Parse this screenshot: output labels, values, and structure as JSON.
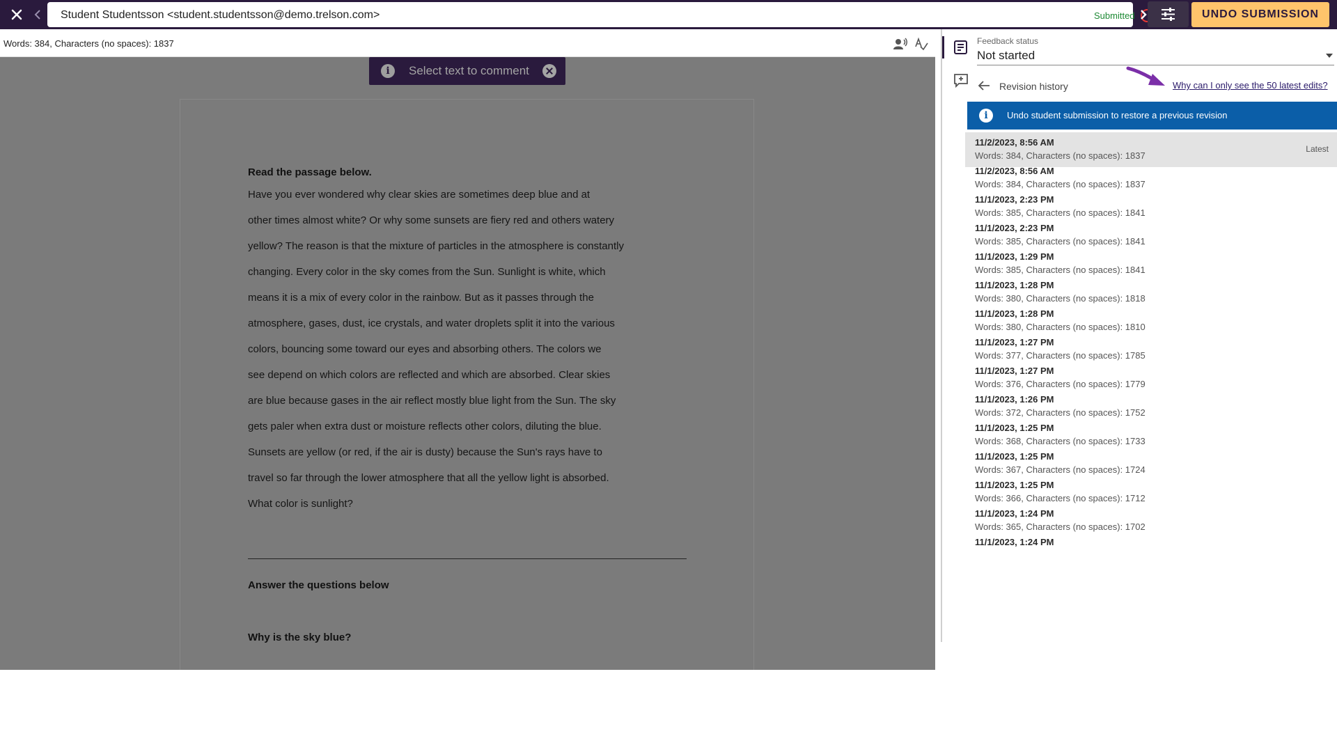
{
  "topbar": {
    "student_name": "Student Studentsson <student.studentsson@demo.trelson.com>",
    "status": "Submitted",
    "undo_label": "UNDO SUBMISSION",
    "colors": {
      "bar": "#2a1a3d",
      "undo": "#ffc46b",
      "status": "#1e8a35",
      "status_circle": "#e53935"
    }
  },
  "document": {
    "stats": "Words: 384, Characters (no spaces): 1837",
    "toast": "Select text to comment",
    "passage_heading": "Read the passage below.",
    "passage_lines": [
      "Have you ever wondered why clear skies are sometimes deep blue and at",
      "other times almost white? Or why some sunsets are fiery red and others watery",
      "yellow? The reason is that the mixture of particles in the atmosphere is constantly",
      "changing. Every color in the sky comes from the Sun. Sunlight is white, which",
      "means it is a mix of every color in the rainbow. But as it passes through the",
      "atmosphere, gases, dust, ice crystals, and water droplets split it into the various",
      "colors, bouncing some toward our eyes and absorbing others. The colors we",
      "see depend on which colors are reflected and which are absorbed. Clear skies",
      "are blue because gases in the air reflect mostly blue light from the Sun. The sky",
      "gets paler when extra dust or moisture reflects other colors, diluting the blue.",
      "Sunsets are yellow (or red, if the air is dusty) because the Sun's rays have to",
      "travel so far through the lower atmosphere that all the yellow light is absorbed.",
      "What color is sunlight?"
    ],
    "answers_heading": "Answer the questions below",
    "question_1": "Why is the sky blue?"
  },
  "sidebar": {
    "feedback_label": "Feedback status",
    "feedback_value": "Not started",
    "revision_title": "Revision history",
    "why_link": "Why can I only see the 50 latest edits?",
    "banner": "Undo student submission to restore a previous revision",
    "latest_label": "Latest",
    "colors": {
      "banner": "#0b5ea8",
      "arrow": "#7b2fa8"
    },
    "revisions": [
      {
        "date": "11/2/2023, 8:56 AM",
        "stats": "Words: 384, Characters (no spaces): 1837"
      },
      {
        "date": "11/2/2023, 8:56 AM",
        "stats": "Words: 384, Characters (no spaces): 1837"
      },
      {
        "date": "11/1/2023, 2:23 PM",
        "stats": "Words: 385, Characters (no spaces): 1841"
      },
      {
        "date": "11/1/2023, 2:23 PM",
        "stats": "Words: 385, Characters (no spaces): 1841"
      },
      {
        "date": "11/1/2023, 1:29 PM",
        "stats": "Words: 385, Characters (no spaces): 1841"
      },
      {
        "date": "11/1/2023, 1:28 PM",
        "stats": "Words: 380, Characters (no spaces): 1818"
      },
      {
        "date": "11/1/2023, 1:28 PM",
        "stats": "Words: 380, Characters (no spaces): 1810"
      },
      {
        "date": "11/1/2023, 1:27 PM",
        "stats": "Words: 377, Characters (no spaces): 1785"
      },
      {
        "date": "11/1/2023, 1:27 PM",
        "stats": "Words: 376, Characters (no spaces): 1779"
      },
      {
        "date": "11/1/2023, 1:26 PM",
        "stats": "Words: 372, Characters (no spaces): 1752"
      },
      {
        "date": "11/1/2023, 1:25 PM",
        "stats": "Words: 368, Characters (no spaces): 1733"
      },
      {
        "date": "11/1/2023, 1:25 PM",
        "stats": "Words: 367, Characters (no spaces): 1724"
      },
      {
        "date": "11/1/2023, 1:25 PM",
        "stats": "Words: 366, Characters (no spaces): 1712"
      },
      {
        "date": "11/1/2023, 1:24 PM",
        "stats": "Words: 365, Characters (no spaces): 1702"
      },
      {
        "date": "11/1/2023, 1:24 PM",
        "stats": ""
      }
    ]
  }
}
